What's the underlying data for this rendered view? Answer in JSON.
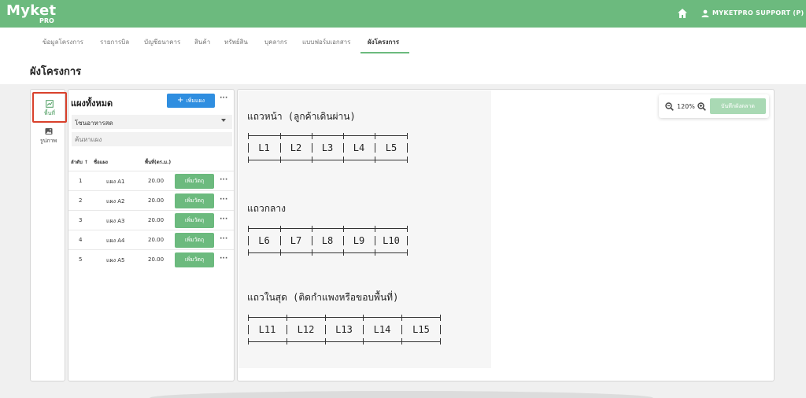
{
  "brand": {
    "name": "Myket",
    "sub": "PRO"
  },
  "header": {
    "user_name": "MYKETPRO SUPPORT (P)"
  },
  "nav": {
    "tabs": [
      {
        "label": "ข้อมูลโครงการ"
      },
      {
        "label": "รายการบิล"
      },
      {
        "label": "บัญชีธนาคาร"
      },
      {
        "label": "สินค้า"
      },
      {
        "label": "ทรัพย์สิน"
      },
      {
        "label": "บุคลากร"
      },
      {
        "label": "แบบฟอร์มเอกสาร"
      },
      {
        "label": "ผังโครงการ"
      }
    ],
    "active_index": 7
  },
  "page_title": "ผังโครงการ",
  "rail": {
    "area_label": "พื้นที่",
    "image_label": "รูปภาพ"
  },
  "list": {
    "title": "แผงทั้งหมด",
    "add_label": "เพิ่มแผง",
    "zone": "โซนอาหารสด",
    "search_placeholder": "ค้นหาแผง",
    "columns": {
      "order": "ลำดับ",
      "name": "ชื่อแผง",
      "area": "พื้นที่(ตร.ม.)"
    },
    "add_item_label": "เพิ่มวัตถุ",
    "rows": [
      {
        "order": "1",
        "name": "แผง A1",
        "area": "20.00"
      },
      {
        "order": "2",
        "name": "แผง A2",
        "area": "20.00"
      },
      {
        "order": "3",
        "name": "แผง A3",
        "area": "20.00"
      },
      {
        "order": "4",
        "name": "แผง A4",
        "area": "20.00"
      },
      {
        "order": "5",
        "name": "แผง A5",
        "area": "20.00"
      }
    ]
  },
  "plan": {
    "rows": [
      {
        "label": "แถวหน้า (ลูกค้าเดินผ่าน)",
        "stalls": [
          "L1",
          "L2",
          "L3",
          "L4",
          "L5"
        ]
      },
      {
        "label": "แถวกลาง",
        "stalls": [
          "L6",
          "L7",
          "L8",
          "L9",
          "L10"
        ]
      },
      {
        "label": "แถวในสุด (ติดกำแพงหรือขอบพื้นที่)",
        "stalls": [
          "L11",
          "L12",
          "L13",
          "L14",
          "L15"
        ]
      }
    ]
  },
  "zoom": {
    "level": "120%",
    "save_label": "บันทึกผังตลาด"
  },
  "colors": {
    "brand": "#6cba7e",
    "primary_button": "#2f8ee0",
    "highlight": "#d9412c"
  }
}
